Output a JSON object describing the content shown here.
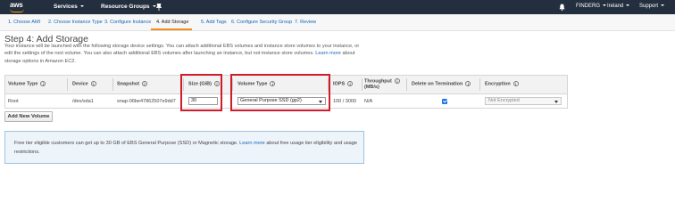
{
  "topnav": {
    "logo": "aws",
    "services": "Services",
    "resource_groups": "Resource Groups",
    "account": "FINDERG",
    "region": "Ireland",
    "support": "Support"
  },
  "tabs": [
    {
      "label": "1. Choose AMI"
    },
    {
      "label": "2. Choose Instance Type"
    },
    {
      "label": "3. Configure Instance"
    },
    {
      "label": "4. Add Storage"
    },
    {
      "label": "5. Add Tags"
    },
    {
      "label": "6. Configure Security Group"
    },
    {
      "label": "7. Review"
    }
  ],
  "heading": "Step 4: Add Storage",
  "description": {
    "text": "Your instance will be launched with the following storage device settings. You can attach additional EBS volumes and instance store volumes to your instance, or edit the settings of the root volume. You can also attach additional EBS volumes after launching an instance, but not instance store volumes. ",
    "link": "Learn more",
    "suffix": " about storage options in Amazon EC2."
  },
  "table": {
    "headers": {
      "volume_type": "Volume Type",
      "device": "Device",
      "snapshot": "Snapshot",
      "size": "Size (GiB)",
      "vol_type": "Volume Type",
      "iops": "IOPS",
      "throughput": "Throughput",
      "throughput_unit": "(MB/s)",
      "delete_on_termination": "Delete on Termination",
      "encryption": "Encryption"
    },
    "row": {
      "volume_type": "Root",
      "device": "/dev/sda1",
      "snapshot": "snap-06be47862507e9dd7",
      "size": "30",
      "vol_type": "General Purpose SSD (gp2)",
      "iops": "100 / 3000",
      "throughput": "N/A",
      "delete_on_termination": true,
      "encryption": "Not Encrypted"
    }
  },
  "add_volume_label": "Add New Volume",
  "info_box": {
    "text": "Free tier eligible customers can get up to 30 GB of EBS General Purpose (SSD) or Magnetic storage. ",
    "link": "Learn more",
    "suffix": " about free usage tier eligibility and usage restrictions."
  },
  "colors": {
    "nav_bg": "#232f3e",
    "accent_orange": "#ff9900",
    "link_blue": "#1166bb",
    "highlight_red": "#d11a2a"
  }
}
